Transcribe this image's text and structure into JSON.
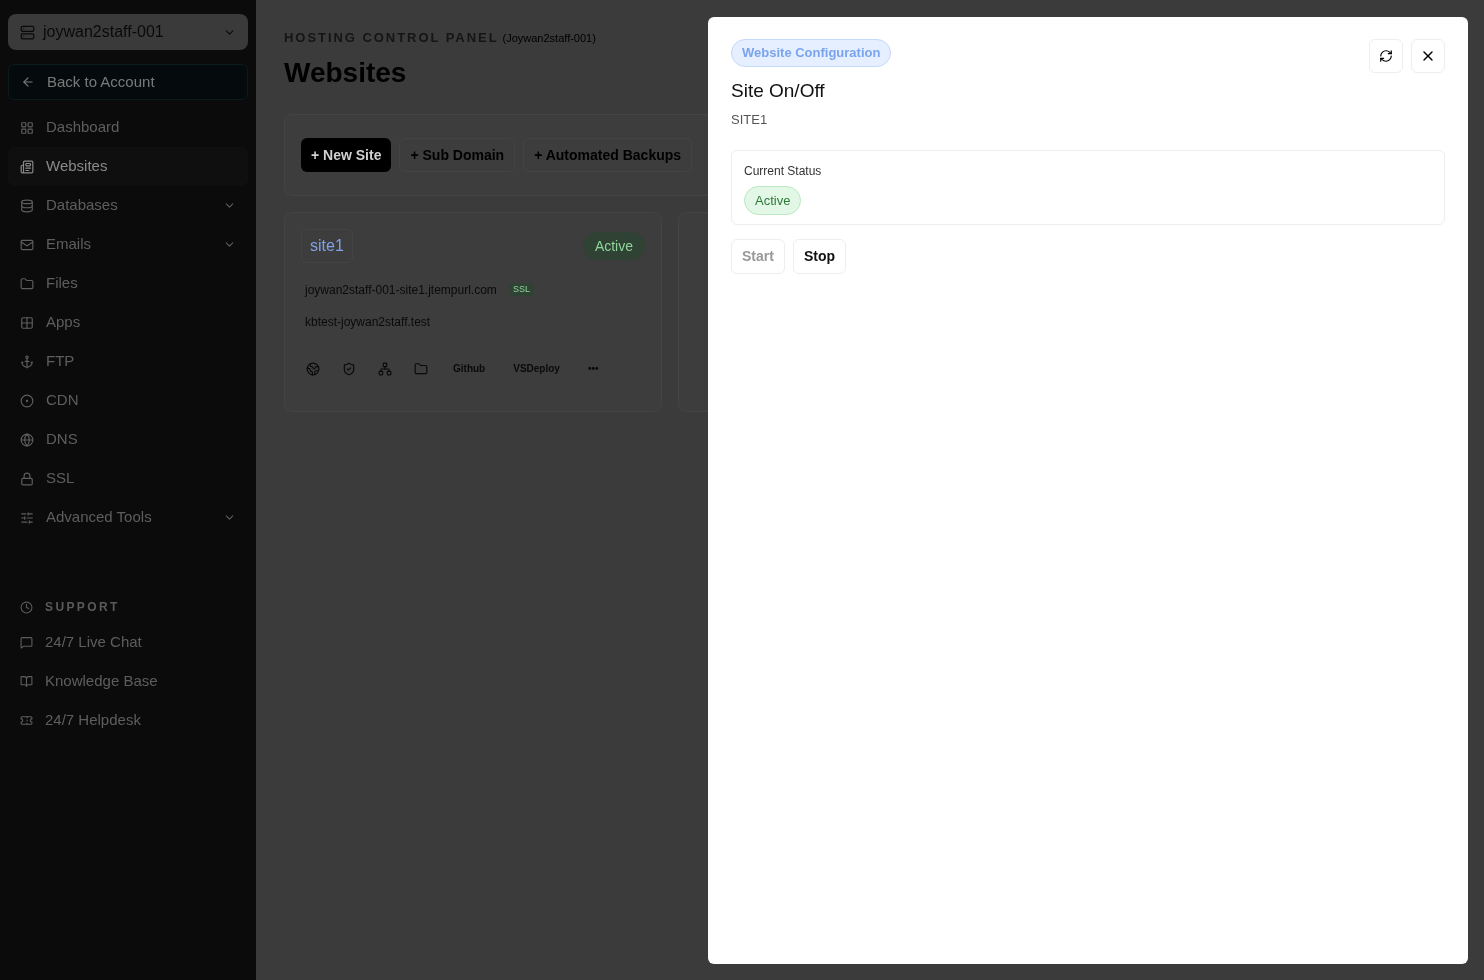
{
  "sidebar": {
    "account": "joywan2staff-001",
    "back_link": "Back to Account",
    "items": [
      {
        "label": "Dashboard",
        "selected": false,
        "expandable": false
      },
      {
        "label": "Websites",
        "selected": true,
        "expandable": false
      },
      {
        "label": "Databases",
        "selected": false,
        "expandable": true
      },
      {
        "label": "Emails",
        "selected": false,
        "expandable": true
      },
      {
        "label": "Files",
        "selected": false,
        "expandable": false
      },
      {
        "label": "Apps",
        "selected": false,
        "expandable": false
      },
      {
        "label": "FTP",
        "selected": false,
        "expandable": false
      },
      {
        "label": "CDN",
        "selected": false,
        "expandable": false
      },
      {
        "label": "DNS",
        "selected": false,
        "expandable": false
      },
      {
        "label": "SSL",
        "selected": false,
        "expandable": false
      },
      {
        "label": "Advanced Tools",
        "selected": false,
        "expandable": true
      }
    ],
    "support_title": "SUPPORT",
    "support_items": [
      "24/7 Live Chat",
      "Knowledge Base",
      "24/7 Helpdesk"
    ]
  },
  "header": {
    "eyebrow": "HOSTING CONTROL PANEL",
    "account": "(Joywan2staff-001)",
    "title": "Websites"
  },
  "toolbar": [
    {
      "label": "+ New Site",
      "primary": true
    },
    {
      "label": "+ Sub Domain",
      "primary": false
    },
    {
      "label": "+ Automated Backups",
      "primary": false
    }
  ],
  "site_card": {
    "name": "site1",
    "status": "Active",
    "domains": [
      {
        "text": "joywan2staff-001-site1.jtempurl.com",
        "ssl": "SSL"
      },
      {
        "text": "kbtest-joywan2staff.test"
      }
    ],
    "actions": [
      "Github",
      "VSDeploy",
      "•••"
    ]
  },
  "modal": {
    "badge": "Website Configuration",
    "title": "Site On/Off",
    "subtitle": "SITE1",
    "status_label": "Current Status",
    "status": "Active",
    "buttons": [
      {
        "label": "Start",
        "disabled": true
      },
      {
        "label": "Stop",
        "disabled": false
      }
    ]
  }
}
